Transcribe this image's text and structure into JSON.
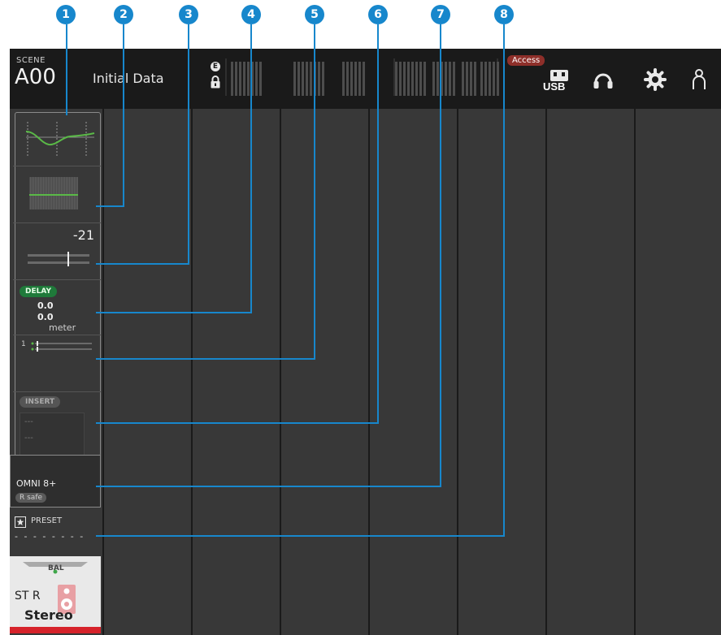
{
  "callouts": [
    "1",
    "2",
    "3",
    "4",
    "5",
    "6",
    "7",
    "8"
  ],
  "scene": {
    "label": "SCENE",
    "number": "A00",
    "title": "Initial Data"
  },
  "status": {
    "edit_badge": "E",
    "access_badge": "Access",
    "usb_label": "USB"
  },
  "icons": [
    "edit-indicator-icon",
    "lock-icon",
    "usb-icon",
    "headphones-icon",
    "settings-icon",
    "user-icon"
  ],
  "channel": {
    "gain_value": "-21",
    "delay_label": "DELAY",
    "delay_value_1": "0.0",
    "delay_value_2": "0.0",
    "delay_unit": "meter",
    "send_index": "1",
    "insert_label": "INSERT",
    "insert_line_1": "---",
    "insert_line_2": "---",
    "port_name": "OMNI 8+",
    "recall_safe": "R safe",
    "preset_label": "PRESET",
    "preset_value": "- - - - - - - -",
    "bal_label": "BAL",
    "channel_id": "ST R",
    "channel_name": "Stereo"
  },
  "colors": {
    "callout": "#1787cc",
    "eq_curve": "#5ab947",
    "delay_pill": "#1f7a3a",
    "access_badge": "#8e2f2a",
    "color_bar": "#d6232b"
  }
}
